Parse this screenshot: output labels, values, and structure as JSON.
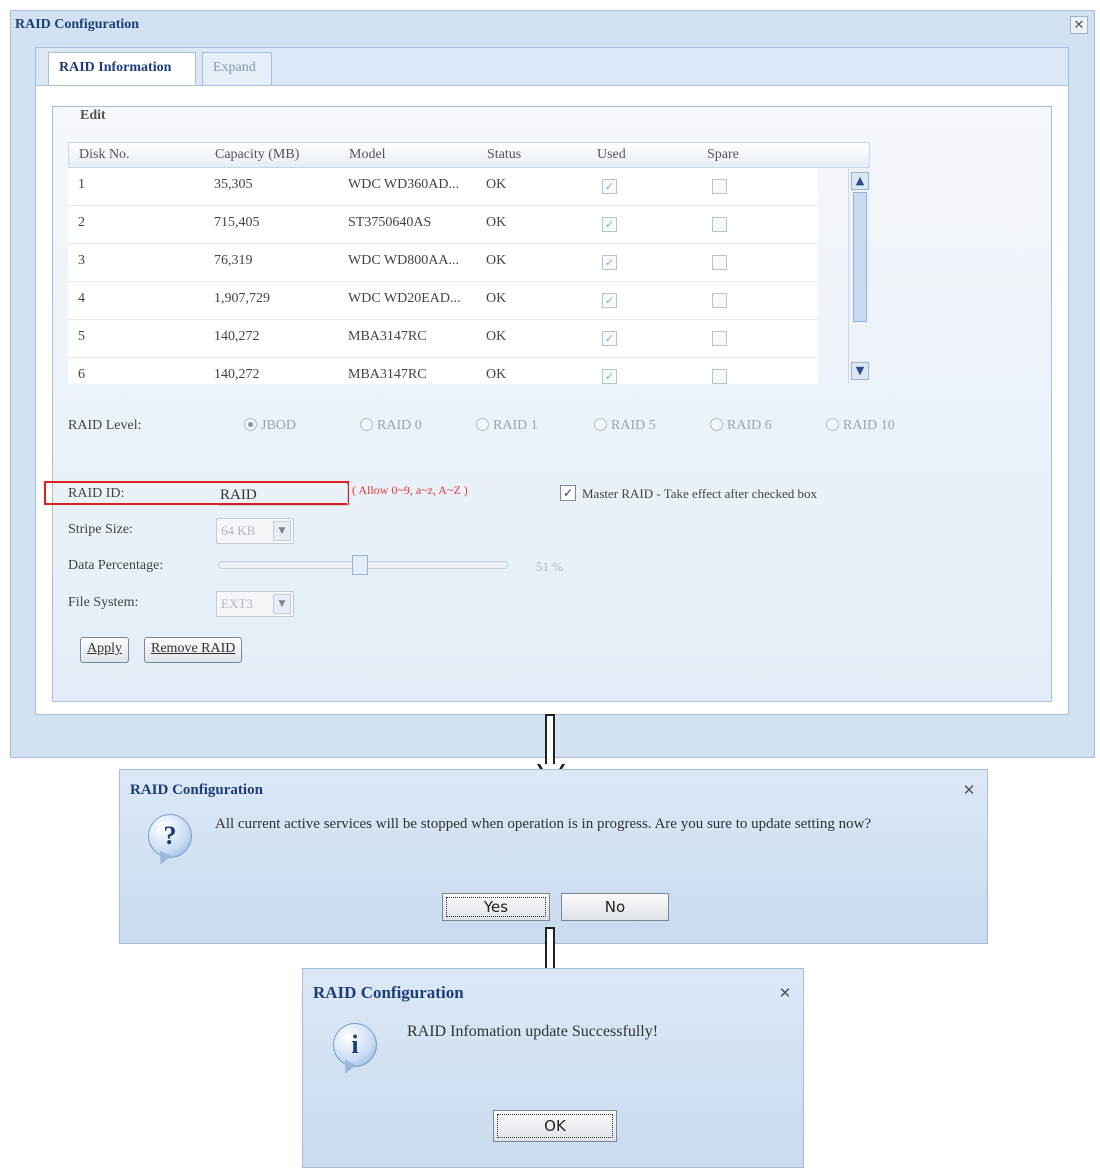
{
  "main_window": {
    "title": "RAID Configuration",
    "close_glyph": "✕",
    "tabs": [
      {
        "label": "RAID Information",
        "active": true
      },
      {
        "label": "Expand",
        "active": false
      }
    ],
    "edit_legend": "Edit",
    "table": {
      "columns": [
        "Disk No.",
        "Capacity (MB)",
        "Model",
        "Status",
        "Used",
        "Spare"
      ],
      "rows": [
        {
          "disk": "1",
          "capacity": "35,305",
          "model": "WDC WD360AD...",
          "status": "OK",
          "used": true,
          "spare": false
        },
        {
          "disk": "2",
          "capacity": "715,405",
          "model": "ST3750640AS",
          "status": "OK",
          "used": true,
          "spare": false
        },
        {
          "disk": "3",
          "capacity": "76,319",
          "model": "WDC WD800AA...",
          "status": "OK",
          "used": true,
          "spare": false
        },
        {
          "disk": "4",
          "capacity": "1,907,729",
          "model": "WDC WD20EAD...",
          "status": "OK",
          "used": true,
          "spare": false
        },
        {
          "disk": "5",
          "capacity": "140,272",
          "model": "MBA3147RC",
          "status": "OK",
          "used": true,
          "spare": false
        },
        {
          "disk": "6",
          "capacity": "140,272",
          "model": "MBA3147RC",
          "status": "OK",
          "used": true,
          "spare": false
        }
      ]
    },
    "raid_level": {
      "label": "RAID Level:",
      "options": [
        "JBOD",
        "RAID 0",
        "RAID 1",
        "RAID 5",
        "RAID 6",
        "RAID 10"
      ],
      "selected": "JBOD"
    },
    "raid_id": {
      "label": "RAID ID:",
      "value": "RAID",
      "hint": "( Allow 0~9, a~z, A~Z )"
    },
    "master_raid": {
      "checked": true,
      "label": "Master RAID - Take effect after checked box"
    },
    "stripe_size": {
      "label": "Stripe Size:",
      "value": "64 KB"
    },
    "data_percentage": {
      "label": "Data Percentage:",
      "value": "51 %",
      "fraction": 0.51
    },
    "file_system": {
      "label": "File System:",
      "value": "EXT3"
    },
    "buttons": {
      "apply": "Apply",
      "remove": "Remove RAID"
    }
  },
  "confirm_dialog": {
    "title": "RAID Configuration",
    "close_glyph": "✕",
    "icon": "question-icon",
    "icon_glyph": "?",
    "message": "All current active services will be stopped when operation is in progress. Are you sure to update setting now?",
    "yes_label": "Yes",
    "no_label": "No"
  },
  "info_dialog": {
    "title": "RAID Configuration",
    "close_glyph": "✕",
    "icon": "info-icon",
    "icon_glyph": "i",
    "message": "RAID Infomation update Successfully!",
    "ok_label": "OK"
  }
}
